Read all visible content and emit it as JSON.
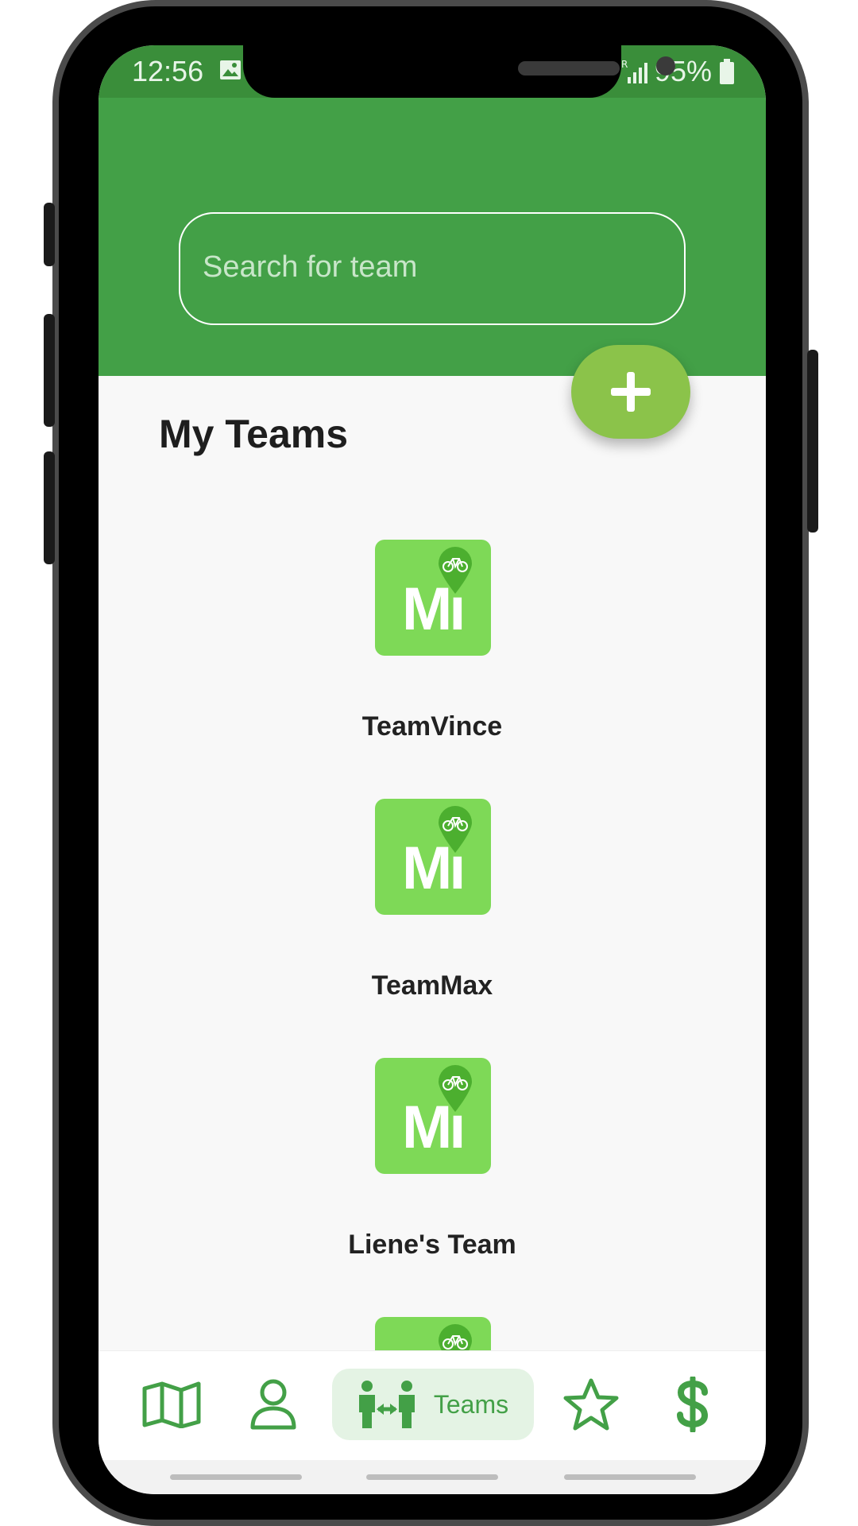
{
  "status": {
    "time": "12:56",
    "battery": "95%",
    "image_icon": "image-icon",
    "signal_icon": "signal-icon",
    "battery_icon": "battery-icon"
  },
  "search": {
    "placeholder": "Search for team"
  },
  "section": {
    "title": "My Teams"
  },
  "add_button": {
    "icon": "plus-icon"
  },
  "teams": [
    {
      "name": "TeamVince",
      "logo_text": "Mı"
    },
    {
      "name": "TeamMax",
      "logo_text": "Mı"
    },
    {
      "name": "Liene's Team",
      "logo_text": "Mı"
    },
    {
      "name": "",
      "logo_text": ""
    }
  ],
  "nav": {
    "items": [
      {
        "icon": "map-icon",
        "label": ""
      },
      {
        "icon": "person-icon",
        "label": ""
      },
      {
        "icon": "teams-icon",
        "label": "Teams",
        "active": true
      },
      {
        "icon": "star-icon",
        "label": ""
      },
      {
        "icon": "dollar-icon",
        "label": ""
      }
    ]
  },
  "colors": {
    "header_green": "#43a047",
    "status_green": "#3a8e3a",
    "fab_green": "#8bc34a",
    "logo_green": "#7ed957",
    "pin_green": "#4caf2f",
    "active_tab_bg": "#e4f3e4"
  }
}
